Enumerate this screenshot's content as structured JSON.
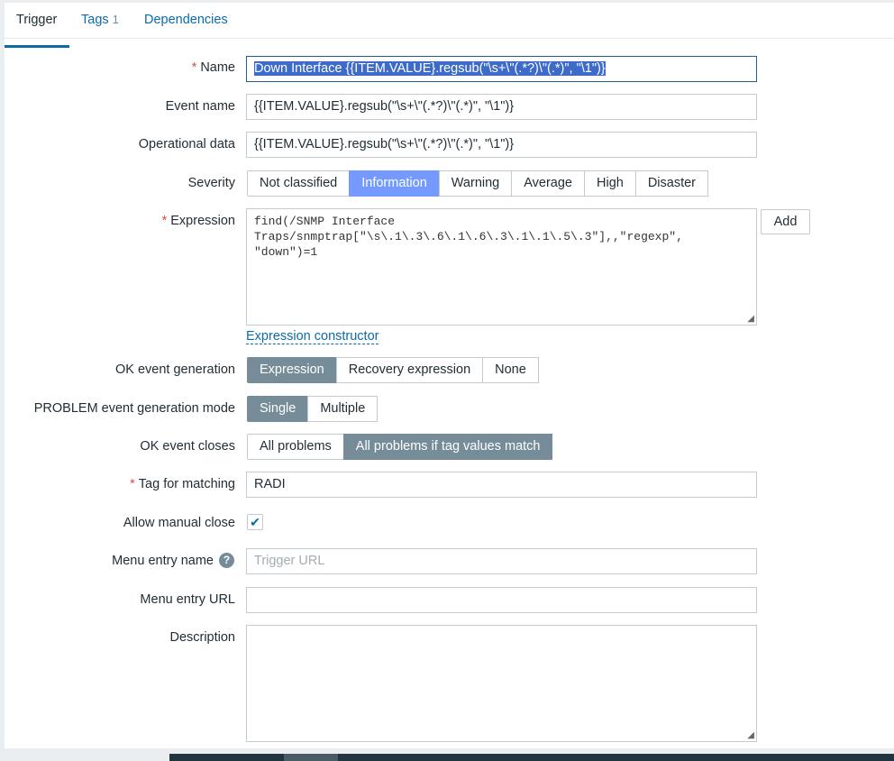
{
  "tabs": [
    {
      "label": "Trigger"
    },
    {
      "label": "Tags",
      "count": "1"
    },
    {
      "label": "Dependencies"
    }
  ],
  "form": {
    "name": {
      "label": "Name",
      "value": "Down Interface {{ITEM.VALUE}.regsub(\"\\s+\\\"(.*?)\\\"(.*)\", \"\\1\")}"
    },
    "event_name": {
      "label": "Event name",
      "value": "{{ITEM.VALUE}.regsub(\"\\s+\\\"(.*?)\\\"(.*)\", \"\\1\")}"
    },
    "operational_data": {
      "label": "Operational data",
      "value": "{{ITEM.VALUE}.regsub(\"\\s+\\\"(.*?)\\\"(.*)\", \"\\1\")}"
    },
    "severity": {
      "label": "Severity",
      "options": [
        "Not classified",
        "Information",
        "Warning",
        "Average",
        "High",
        "Disaster"
      ],
      "selected": "Information"
    },
    "expression": {
      "label": "Expression",
      "value": "find(/SNMP Interface Traps/snmptrap[\"\\s\\.1\\.3\\.6\\.1\\.6\\.3\\.1\\.1\\.5\\.3\"],,\"regexp\",\n\"down\")=1",
      "add_label": "Add",
      "constructor_link": "Expression constructor"
    },
    "ok_event_generation": {
      "label": "OK event generation",
      "options": [
        "Expression",
        "Recovery expression",
        "None"
      ],
      "selected": "Expression"
    },
    "problem_mode": {
      "label": "PROBLEM event generation mode",
      "options": [
        "Single",
        "Multiple"
      ],
      "selected": "Single"
    },
    "ok_event_closes": {
      "label": "OK event closes",
      "options": [
        "All problems",
        "All problems if tag values match"
      ],
      "selected": "All problems if tag values match"
    },
    "tag_for_matching": {
      "label": "Tag for matching",
      "value": "RADI"
    },
    "allow_manual_close": {
      "label": "Allow manual close",
      "checked": true
    },
    "menu_entry_name": {
      "label": "Menu entry name",
      "placeholder": "Trigger URL",
      "value": ""
    },
    "menu_entry_url": {
      "label": "Menu entry URL",
      "value": ""
    },
    "description": {
      "label": "Description",
      "value": ""
    }
  }
}
